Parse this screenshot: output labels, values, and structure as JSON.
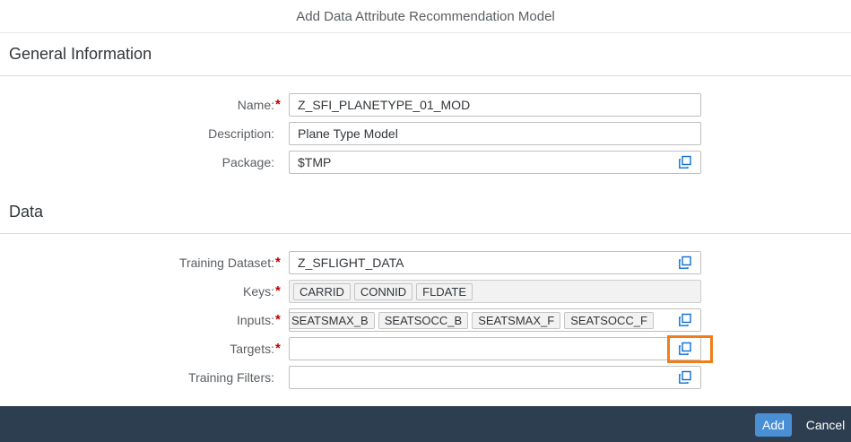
{
  "dialog": {
    "title": "Add Data Attribute Recommendation Model"
  },
  "general": {
    "heading": "General Information",
    "name": {
      "label": "Name:",
      "value": "Z_SFI_PLANETYPE_01_MOD",
      "required": true
    },
    "description": {
      "label": "Description:",
      "value": "Plane Type Model"
    },
    "package": {
      "label": "Package:",
      "value": "$TMP",
      "icon": "value-help-icon"
    }
  },
  "data": {
    "heading": "Data",
    "training_dataset": {
      "label": "Training Dataset:",
      "value": "Z_SFLIGHT_DATA",
      "required": true,
      "icon": "value-help-icon"
    },
    "keys": {
      "label": "Keys:",
      "required": true,
      "tokens": [
        "CARRID",
        "CONNID",
        "FLDATE"
      ]
    },
    "inputs": {
      "label": "Inputs:",
      "required": true,
      "tokens": [
        "SEATSMAX_B",
        "SEATSOCC_B",
        "SEATSMAX_F",
        "SEATSOCC_F"
      ],
      "icon": "value-help-icon"
    },
    "targets": {
      "label": "Targets:",
      "required": true,
      "value": "",
      "icon": "value-help-icon"
    },
    "training_filters": {
      "label": "Training Filters:",
      "value": "",
      "icon": "value-help-icon"
    }
  },
  "footer": {
    "add_label": "Add",
    "cancel_label": "Cancel"
  },
  "colors": {
    "footer_bg": "#2c3e50",
    "primary_button": "#4a8fd3",
    "required_marker": "#bb0000",
    "highlight": "#f07d1a"
  }
}
